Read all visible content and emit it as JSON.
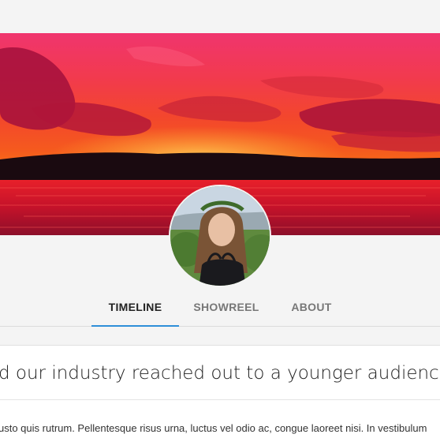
{
  "tabs": [
    {
      "label": "TIMELINE",
      "active": true
    },
    {
      "label": "SHOWREEL",
      "active": false
    },
    {
      "label": "ABOUT",
      "active": false
    }
  ],
  "post": {
    "headline": "d our industry reached out to a younger audience.",
    "body": "usto quis rutrum. Pellentesque risus urna, luctus vel odio ac, congue laoreet nisi. In vestibulum"
  },
  "colors": {
    "tab_indicator": "#2e8fd8",
    "page_background": "#f4f4f4"
  }
}
